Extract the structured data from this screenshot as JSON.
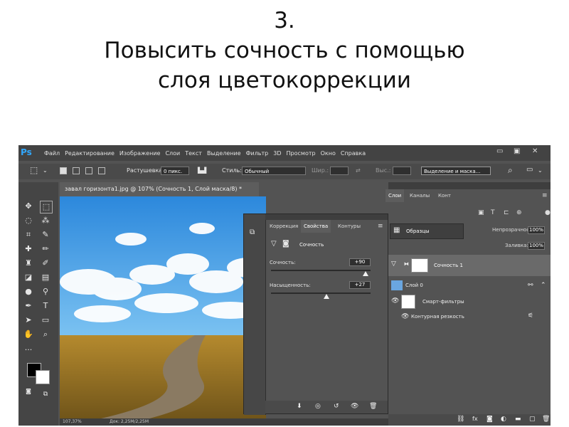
{
  "slide": {
    "number": "3.",
    "line1": "Повысить сочность с помощью",
    "line2": "слоя цветокоррекции"
  },
  "app": {
    "logo": "Ps",
    "menu": [
      "Файл",
      "Редактирование",
      "Изображение",
      "Слои",
      "Текст",
      "Выделение",
      "Фильтр",
      "3D",
      "Просмотр",
      "Окно",
      "Справка"
    ],
    "window_controls": {
      "minimize": "▭",
      "restore": "▣",
      "close": "✕"
    }
  },
  "options_bar": {
    "feather_label": "Растушевка:",
    "feather_value": "0 пикс.",
    "style_label": "Стиль:",
    "style_value": "Обычный",
    "width_label": "Шир.:",
    "height_label": "Выс.:",
    "select_mask_button": "Выделение и маска..."
  },
  "document": {
    "tab_title": "завал горизонта1.jpg @ 107% (Сочность 1, Слой маска/8) *",
    "zoom": "107,37%",
    "doc_info": "Док: 2,25M/2,25M"
  },
  "properties_panel": {
    "tabs": [
      "Коррекция",
      "Свойства",
      "Контуры"
    ],
    "active_tab": "Свойства",
    "title": "Сочность",
    "vibrance_label": "Сочность:",
    "vibrance_value": "+90",
    "vibrance_level": 0.95,
    "saturation_label": "Насыщенность:",
    "saturation_value": "+27",
    "saturation_level": 0.56
  },
  "swatches_panel": {
    "title": "Образцы"
  },
  "layers_panel": {
    "tabs": [
      "Слои",
      "Каналы",
      "Конт"
    ],
    "opacity_label": "Непрозрачность:",
    "opacity_value": "100%",
    "fill_label": "Заливка:",
    "fill_value": "100%",
    "layers": [
      {
        "name": "Сочность 1"
      },
      {
        "name": "Слой 0"
      },
      {
        "name": "Смарт-фильтры"
      },
      {
        "name": "Контурная резкость"
      }
    ]
  },
  "colors": {
    "ui_bg": "#535353",
    "menu_bg": "#434343",
    "ps_blue": "#31a8ff"
  }
}
